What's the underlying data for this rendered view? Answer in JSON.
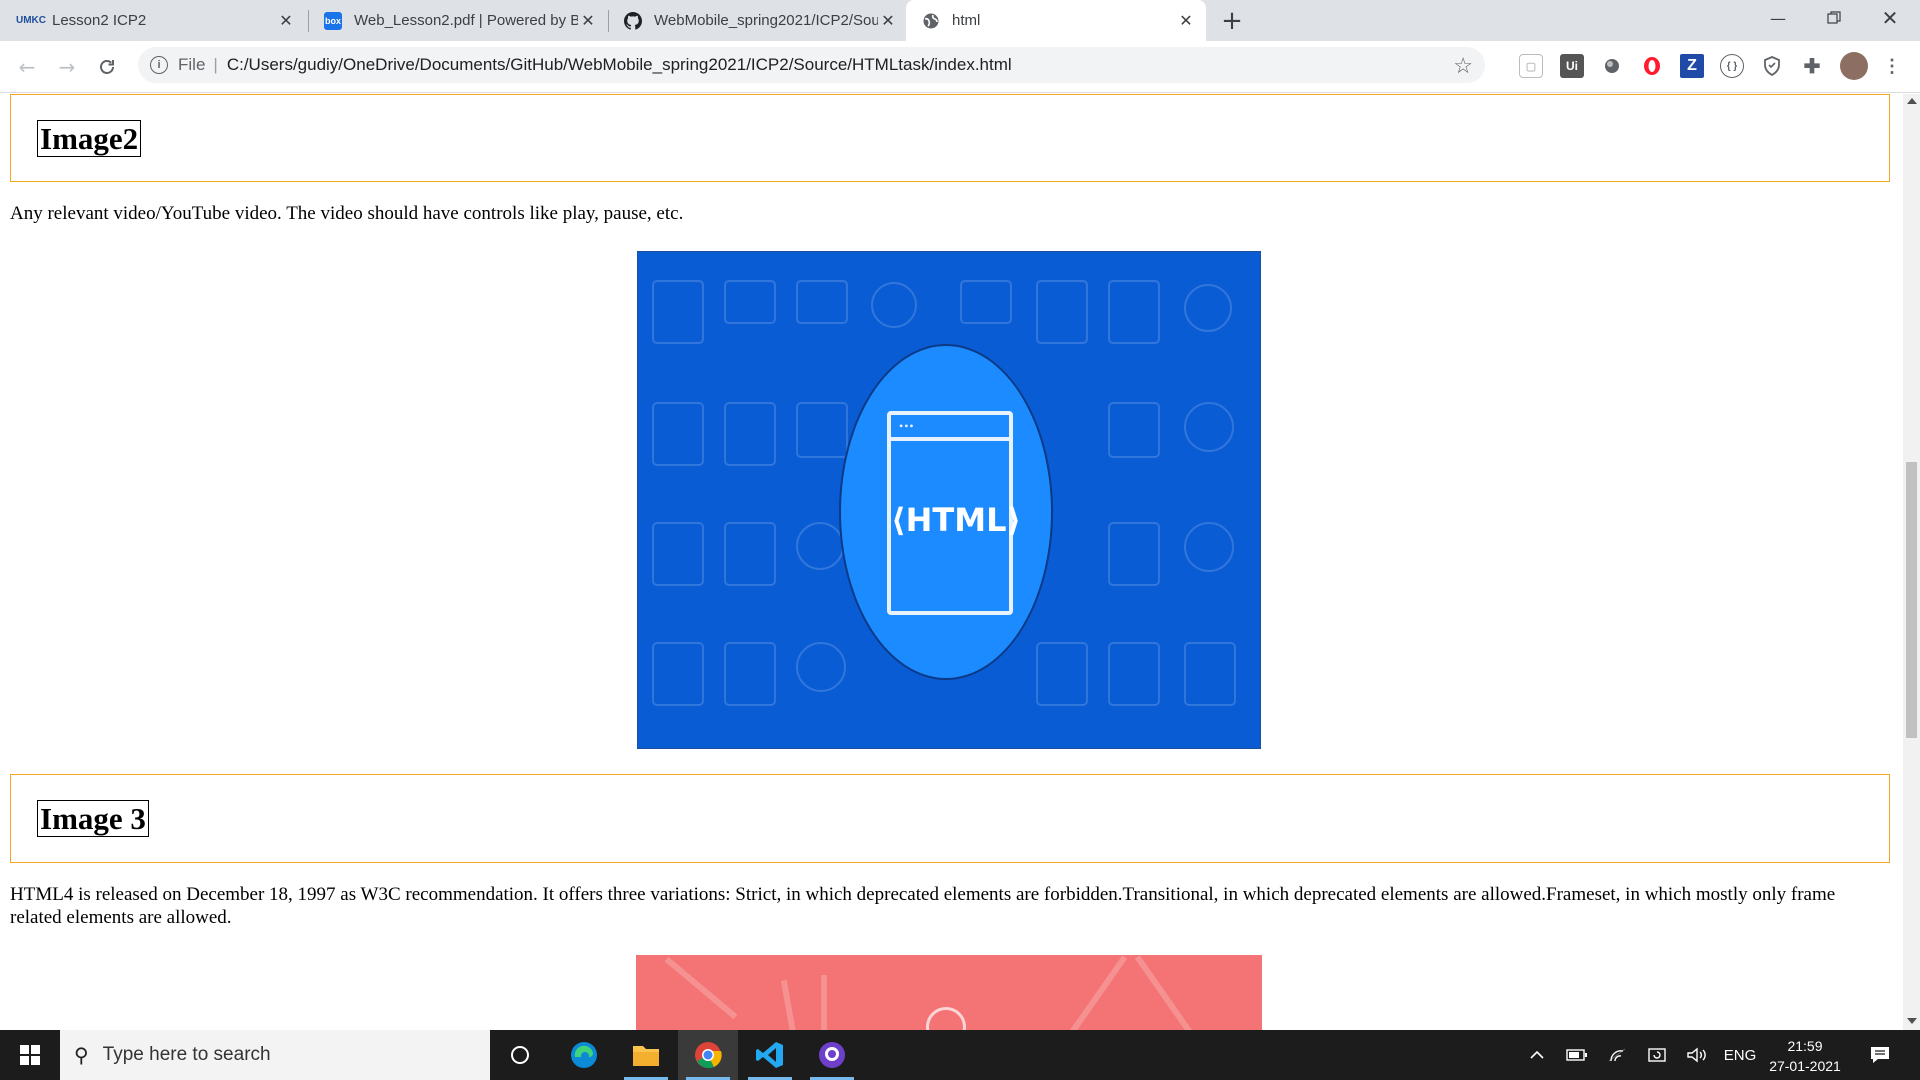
{
  "browser": {
    "tabs": [
      {
        "title": "Lesson2 ICP2",
        "favicon": "umkc-logo-icon",
        "active": false
      },
      {
        "title": "Web_Lesson2.pdf | Powered by B",
        "favicon": "box-logo-icon",
        "active": false
      },
      {
        "title": "WebMobile_spring2021/ICP2/Sou",
        "favicon": "github-icon",
        "active": false
      },
      {
        "title": "html",
        "favicon": "globe-icon",
        "active": true
      }
    ],
    "address": {
      "scheme_label": "File",
      "url": "C:/Users/gudiy/OneDrive/Documents/GitHub/WebMobile_spring2021/ICP2/Source/HTMLtask/index.html"
    },
    "extensions": [
      "pocket-icon",
      "uipath-icon",
      "circle-extension-icon",
      "opera-icon",
      "zotero-icon",
      "json-viewer-icon",
      "shield-icon",
      "puzzle-icon",
      "profile-avatar"
    ]
  },
  "page": {
    "section1": {
      "heading": "Image2",
      "paragraph": "Any relevant video/YouTube video. The video should have controls like play, pause, etc."
    },
    "image1": {
      "text": "⟨HTML⟩",
      "bg_color": "#0a5cd5",
      "circle_color": "#1c8bff"
    },
    "section2": {
      "heading": "Image 3",
      "paragraph": "HTML4 is released on December 18, 1997 as W3C recommendation. It offers three variations: Strict, in which deprecated elements are forbidden.Transitional, in which deprecated elements are allowed.Frameset, in which mostly only frame related elements are allowed."
    },
    "image2": {
      "bg_color": "#f47374"
    },
    "box_border_color": "#f5a623"
  },
  "taskbar": {
    "search_placeholder": "Type here to search",
    "apps": [
      "cortana-icon",
      "edge-icon",
      "file-explorer-icon",
      "chrome-icon",
      "vscode-icon",
      "github-desktop-icon"
    ],
    "tray": {
      "language": "ENG",
      "time": "21:59",
      "date": "27-01-2021"
    }
  }
}
